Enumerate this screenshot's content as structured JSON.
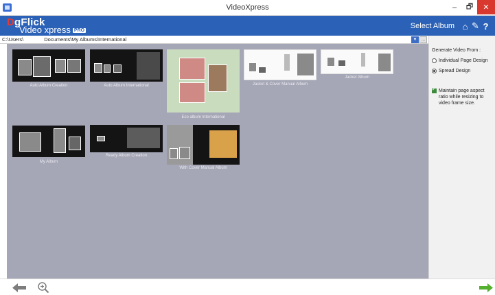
{
  "window": {
    "title": "VideoXpress",
    "minimize": "–",
    "restore": "🗗",
    "close": "✕"
  },
  "header": {
    "logo_brand_d": "D",
    "logo_brand_rest": "gFlick",
    "logo_sub": "Video xpress",
    "logo_badge": "PRO",
    "select_album": "Select Album",
    "home_icon": "⌂",
    "wrench_icon": "✎",
    "help_icon": "?"
  },
  "pathbar": {
    "path_prefix": "C:\\Users\\",
    "path_rest": "Documents\\My Albums\\International",
    "dropdown": "▼",
    "browse": "..."
  },
  "albums": [
    {
      "label": "Auto Album Creation"
    },
    {
      "label": "Auto Album International"
    },
    {
      "label": "Eco album International"
    },
    {
      "label": "Jacket & Cover Manual Album"
    },
    {
      "label": "Jacket Album"
    },
    {
      "label": "My Album"
    },
    {
      "label": "Ready Album Creation"
    },
    {
      "label": "With Cover Manual Album"
    }
  ],
  "right_panel": {
    "title": "Generate Video From :",
    "option_individual": "Individual Page Design",
    "option_spread": "Spread Design",
    "spread_selected": true,
    "aspect_label": "Maintain page aspect ratio while resizing to video frame size.",
    "aspect_checked": true
  },
  "colors": {
    "header_blue": "#2b62b8",
    "main_bg": "#a5a6b6",
    "next_green": "#55b030",
    "back_gray": "#7d7d7d",
    "close_red": "#d9382f"
  },
  "icons": {
    "back": "back-arrow-icon",
    "zoom": "zoom-icon",
    "next": "next-arrow-icon"
  }
}
